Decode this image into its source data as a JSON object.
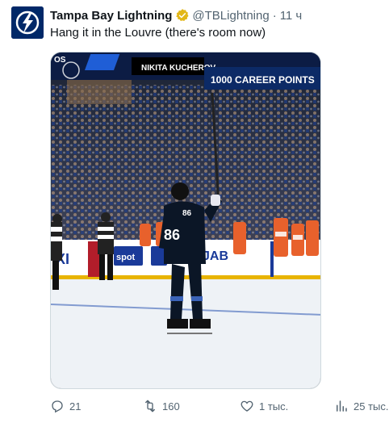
{
  "tweet": {
    "author_name": "Tampa Bay Lightning",
    "handle": "@TBLightning",
    "separator": "·",
    "time": "11 ч",
    "text": "Hang it in the Louvre (there's room now)",
    "verified_color": "#e2b719"
  },
  "media": {
    "banner_name": "NIKITA KUCHEROV",
    "banner_caption": "1000 CAREER POINTS",
    "banner_prefix": "OS",
    "jersey_number": "86",
    "board_ads": [
      "XI",
      "spot",
      "JAB",
      "spot"
    ],
    "ice_color": "#eef2f6",
    "jersey_color": "#0b1626"
  },
  "actions": {
    "replies": "21",
    "reposts": "160",
    "likes": "1 тыс.",
    "views": "25 тыс."
  },
  "colors": {
    "text_primary": "#0f1419",
    "text_secondary": "#536471",
    "brand_blue": "#002868"
  }
}
